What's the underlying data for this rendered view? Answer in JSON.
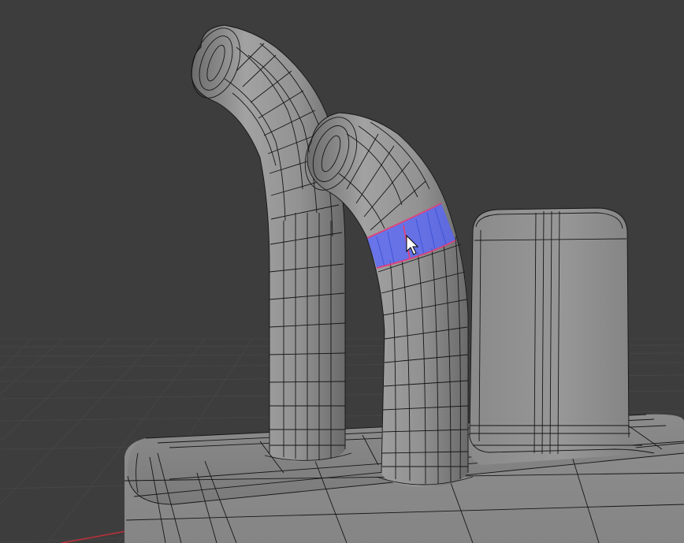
{
  "app": "3D viewport",
  "viewport": {
    "background_color": "#3d3d3d",
    "grid_color": "#4a4a4a",
    "x_axis_color": "#c0303a",
    "mesh_color": "#8e8e8e",
    "wire_color": "#161616",
    "selection_face_color": "#5566ff",
    "selection_edge_color": "#e0407a"
  },
  "objects": [
    {
      "name": "left-bent-tube",
      "selected": false
    },
    {
      "name": "right-bent-tube",
      "selected": false,
      "selection": "edge-loop-faces"
    },
    {
      "name": "rounded-box-column",
      "selected": false
    },
    {
      "name": "base-block",
      "selected": false
    }
  ],
  "cursor": {
    "icon": "arrow-cursor-icon"
  }
}
